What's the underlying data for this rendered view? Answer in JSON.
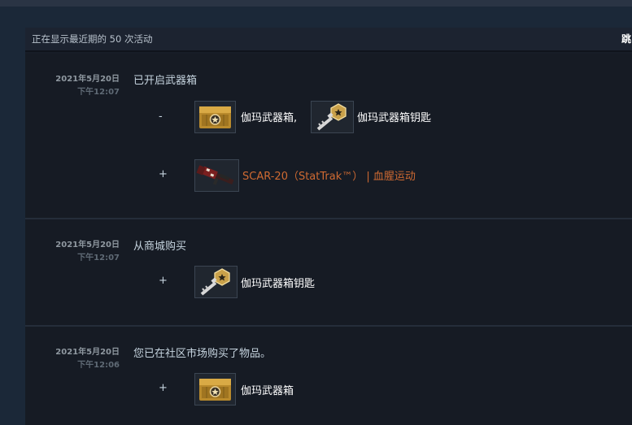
{
  "header": {
    "count_text": "正在显示最近期的 50 次活动",
    "jump_text": "跳"
  },
  "entries": [
    {
      "date": "2021年5月20日",
      "time": "下午12:07",
      "description": "已开启武器箱",
      "rows": [
        {
          "sign": "-",
          "items": [
            {
              "icon": "weapon-case-icon",
              "label": "伽玛武器箱,",
              "color": "#ffffff"
            },
            {
              "icon": "case-key-icon",
              "label": "伽玛武器箱钥匙",
              "color": "#ffffff"
            }
          ]
        },
        {
          "sign": "+",
          "items": [
            {
              "icon": "scar-20-rifle-icon",
              "label": "SCAR-20（StatTrak™） | 血腥运动",
              "color": "#cf6a32"
            }
          ]
        }
      ]
    },
    {
      "date": "2021年5月20日",
      "time": "下午12:07",
      "description": "从商城购买",
      "rows": [
        {
          "sign": "+",
          "items": [
            {
              "icon": "case-key-icon",
              "label": "伽玛武器箱钥匙",
              "color": "#ffffff"
            }
          ]
        }
      ]
    },
    {
      "date": "2021年5月20日",
      "time": "下午12:06",
      "description": "您已在社区市场购买了物品。",
      "rows": [
        {
          "sign": "+",
          "items": [
            {
              "icon": "weapon-case-icon",
              "label": "伽玛武器箱",
              "color": "#ffffff"
            }
          ]
        }
      ]
    }
  ]
}
